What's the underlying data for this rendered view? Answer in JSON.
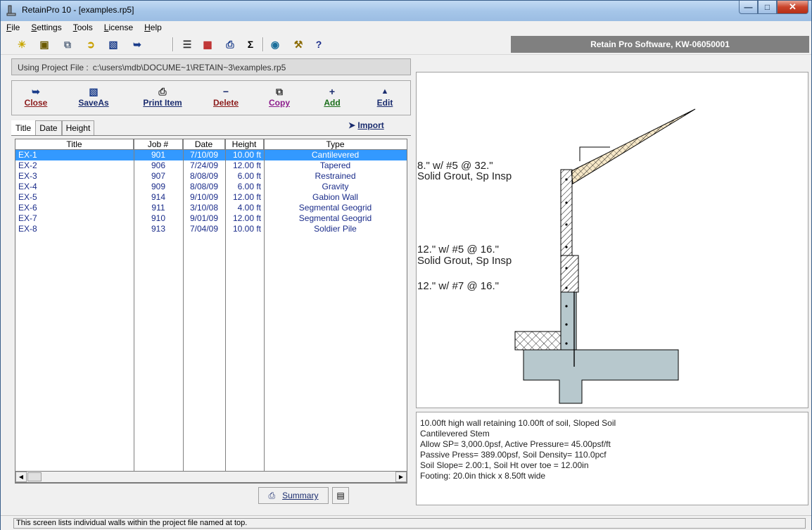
{
  "window": {
    "title": "RetainPro 10 - [examples.rp5]"
  },
  "menu": [
    {
      "key": "F",
      "rest": "ile"
    },
    {
      "key": "S",
      "rest": "ettings"
    },
    {
      "key": "T",
      "rest": "ools"
    },
    {
      "key": "L",
      "rest": "icense"
    },
    {
      "key": "H",
      "rest": "elp"
    }
  ],
  "brand": "Retain Pro Software, KW-06050001",
  "project_file": {
    "label": "Using Project File :",
    "value": "c:\\users\\mdb\\DOCUME~1\\RETAIN~3\\examples.rp5"
  },
  "actions": {
    "close": "Close",
    "saveas": "SaveAs",
    "print": "Print Item",
    "delete": "Delete",
    "copy": "Copy",
    "add": "Add",
    "edit": "Edit"
  },
  "action_colors": {
    "close": "#8b1a1a",
    "saveas": "#1a2c6e",
    "print": "#1a2c6e",
    "delete": "#8b1a1a",
    "copy": "#8b1a8b",
    "add": "#1a6e1a",
    "edit": "#1a2c6e"
  },
  "tabs": [
    "Title",
    "Date",
    "Height"
  ],
  "import_label": "Import",
  "table": {
    "headers": [
      "Title",
      "Job #",
      "Date",
      "Height",
      "Type"
    ],
    "rows": [
      [
        "EX-1",
        "901",
        "7/10/09",
        "10.00 ft",
        "Cantilevered"
      ],
      [
        "EX-2",
        "906",
        "7/24/09",
        "12.00 ft",
        "Tapered"
      ],
      [
        "EX-3",
        "907",
        "8/08/09",
        "6.00 ft",
        "Restrained"
      ],
      [
        "EX-4",
        "909",
        "8/08/09",
        "6.00 ft",
        "Gravity"
      ],
      [
        "EX-5",
        "914",
        "9/10/09",
        "12.00 ft",
        "Gabion Wall"
      ],
      [
        "EX-6",
        "911",
        "3/10/08",
        "4.00 ft",
        "Segmental Geogrid"
      ],
      [
        "EX-7",
        "910",
        "9/01/09",
        "12.00 ft",
        "Segmental Geogrid"
      ],
      [
        "EX-8",
        "913",
        "7/04/09",
        "10.00 ft",
        "Soldier Pile"
      ]
    ]
  },
  "summary_label": "Summary",
  "drawing": {
    "label1a": "8.\" w/ #5 @ 32.\"",
    "label1b": "Solid Grout, Sp Insp",
    "label2a": "12.\" w/ #5 @ 16.\"",
    "label2b": "Solid Grout, Sp Insp",
    "label3": "12.\" w/ #7 @ 16.\""
  },
  "info": [
    "10.00ft high wall retaining 10.00ft of soil, Sloped Soil",
    "Cantilevered Stem",
    "Allow SP= 3,000.0psf, Active Pressure= 45.00psf/ft",
    "Passive Press= 389.00psf, Soil Density= 110.0pcf",
    "Soil Slope= 2.00:1, Soil Ht over toe = 12.00in",
    "Footing: 20.0in thick x 8.50ft wide"
  ],
  "status": "This screen lists individual walls within the project file named at top."
}
